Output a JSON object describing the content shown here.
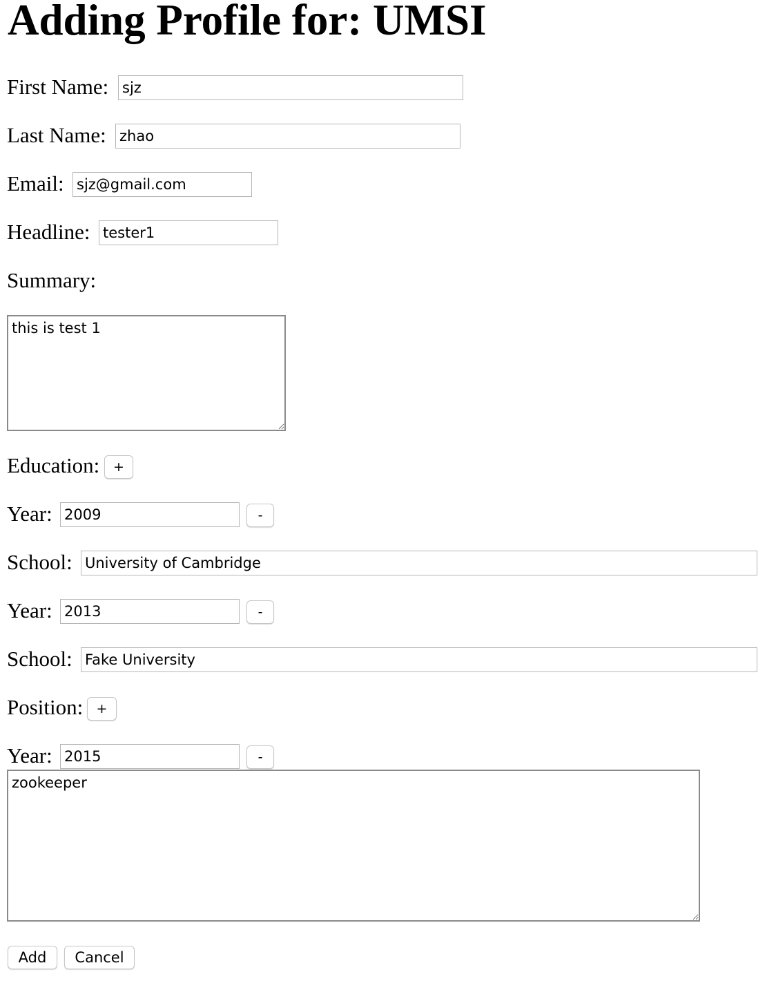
{
  "page": {
    "title": "Adding Profile for: UMSI"
  },
  "profile": {
    "first_name_label": "First Name:",
    "first_name_value": "sjz",
    "last_name_label": "Last Name:",
    "last_name_value": "zhao",
    "email_label": "Email:",
    "email_value": "sjz@gmail.com",
    "headline_label": "Headline:",
    "headline_value": "tester1",
    "summary_label": "Summary:",
    "summary_value": "this is test 1"
  },
  "education": {
    "label": "Education:",
    "add_label": "+",
    "entries": [
      {
        "year_label": "Year:",
        "year_value": "2009",
        "remove_label": "-",
        "school_label": "School:",
        "school_value": "University of Cambridge"
      },
      {
        "year_label": "Year:",
        "year_value": "2013",
        "remove_label": "-",
        "school_label": "School:",
        "school_value": "Fake University"
      }
    ]
  },
  "position": {
    "label": "Position:",
    "add_label": "+",
    "entries": [
      {
        "year_label": "Year:",
        "year_value": "2015",
        "remove_label": "-",
        "description_value": "zookeeper"
      }
    ]
  },
  "actions": {
    "add_label": "Add",
    "cancel_label": "Cancel"
  }
}
